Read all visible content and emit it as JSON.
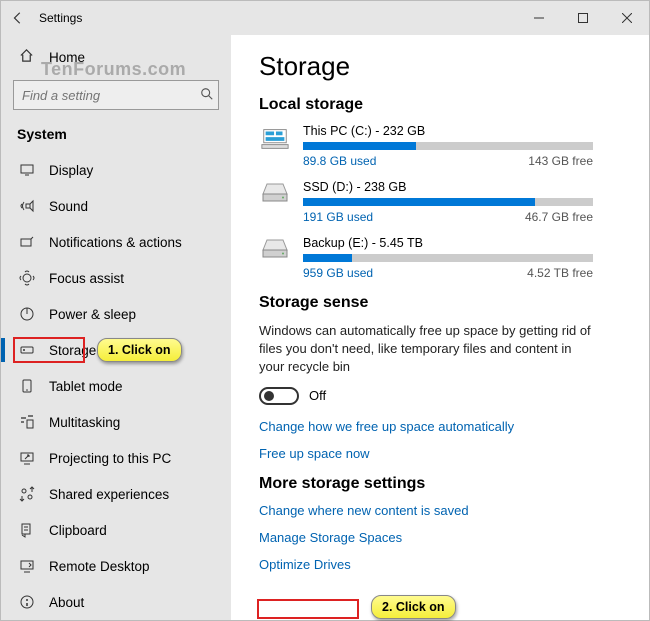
{
  "titlebar": {
    "title": "Settings"
  },
  "watermark": "TenForums.com",
  "sidebar": {
    "home": "Home",
    "search_placeholder": "Find a setting",
    "category": "System",
    "items": [
      {
        "label": "Display"
      },
      {
        "label": "Sound"
      },
      {
        "label": "Notifications & actions"
      },
      {
        "label": "Focus assist"
      },
      {
        "label": "Power & sleep"
      },
      {
        "label": "Storage"
      },
      {
        "label": "Tablet mode"
      },
      {
        "label": "Multitasking"
      },
      {
        "label": "Projecting to this PC"
      },
      {
        "label": "Shared experiences"
      },
      {
        "label": "Clipboard"
      },
      {
        "label": "Remote Desktop"
      },
      {
        "label": "About"
      }
    ],
    "selected_index": 5
  },
  "main": {
    "heading": "Storage",
    "local_heading": "Local storage",
    "drives": [
      {
        "name": "This PC (C:) - 232 GB",
        "used": "89.8 GB used",
        "free": "143 GB free",
        "pct": 39,
        "kind": "pc"
      },
      {
        "name": "SSD (D:) - 238 GB",
        "used": "191 GB used",
        "free": "46.7 GB free",
        "pct": 80,
        "kind": "ssd"
      },
      {
        "name": "Backup (E:) - 5.45 TB",
        "used": "959 GB used",
        "free": "4.52 TB free",
        "pct": 17,
        "kind": "hdd"
      }
    ],
    "sense_heading": "Storage sense",
    "sense_text": "Windows can automatically free up space by getting rid of files you don't need, like temporary files and content in your recycle bin",
    "toggle_label": "Off",
    "sense_links": [
      "Change how we free up space automatically",
      "Free up space now"
    ],
    "more_heading": "More storage settings",
    "more_links": [
      "Change where new content is saved",
      "Manage Storage Spaces",
      "Optimize Drives"
    ]
  },
  "callouts": {
    "one": "1. Click on",
    "two": "2. Click on"
  }
}
